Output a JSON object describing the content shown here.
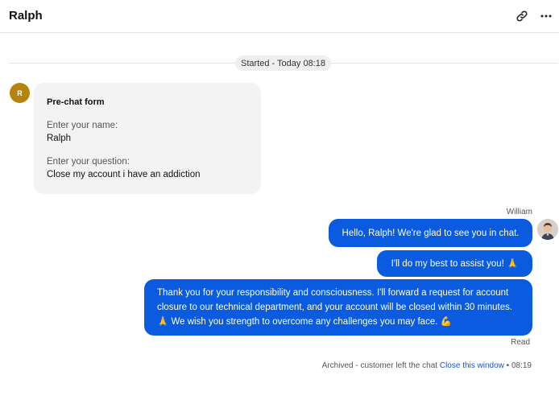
{
  "header": {
    "title": "Ralph",
    "link_icon": "link-icon",
    "more_icon": "more-horizontal-icon"
  },
  "chat": {
    "started_label": "Started - Today 08:18",
    "customer_avatar_initial": "R",
    "prechat_form": {
      "title": "Pre-chat form",
      "fields": [
        {
          "label": "Enter your name:",
          "value": "Ralph"
        },
        {
          "label": "Enter your question:",
          "value": "Close my account i have an addiction"
        }
      ]
    },
    "agent_name": "William",
    "messages": [
      {
        "text": "Hello, Ralph! We're glad to see you in chat."
      },
      {
        "text": "I'll do my best to assist you! 🙏"
      },
      {
        "text": "Thank you for your responsibility and consciousness. I'll forward a request for account closure to our technical department, and your account will be closed within 30 minutes. 🙏 We wish you strength to overcome any challenges you may face. 💪"
      }
    ],
    "read_label": "Read",
    "status": {
      "text": "Archived - customer left the chat",
      "link": "Close this window",
      "separator": "•",
      "time": "08:19"
    }
  },
  "colors": {
    "accent": "#0a5be0",
    "avatar_customer": "#b4840c",
    "link": "#1a56c7"
  }
}
